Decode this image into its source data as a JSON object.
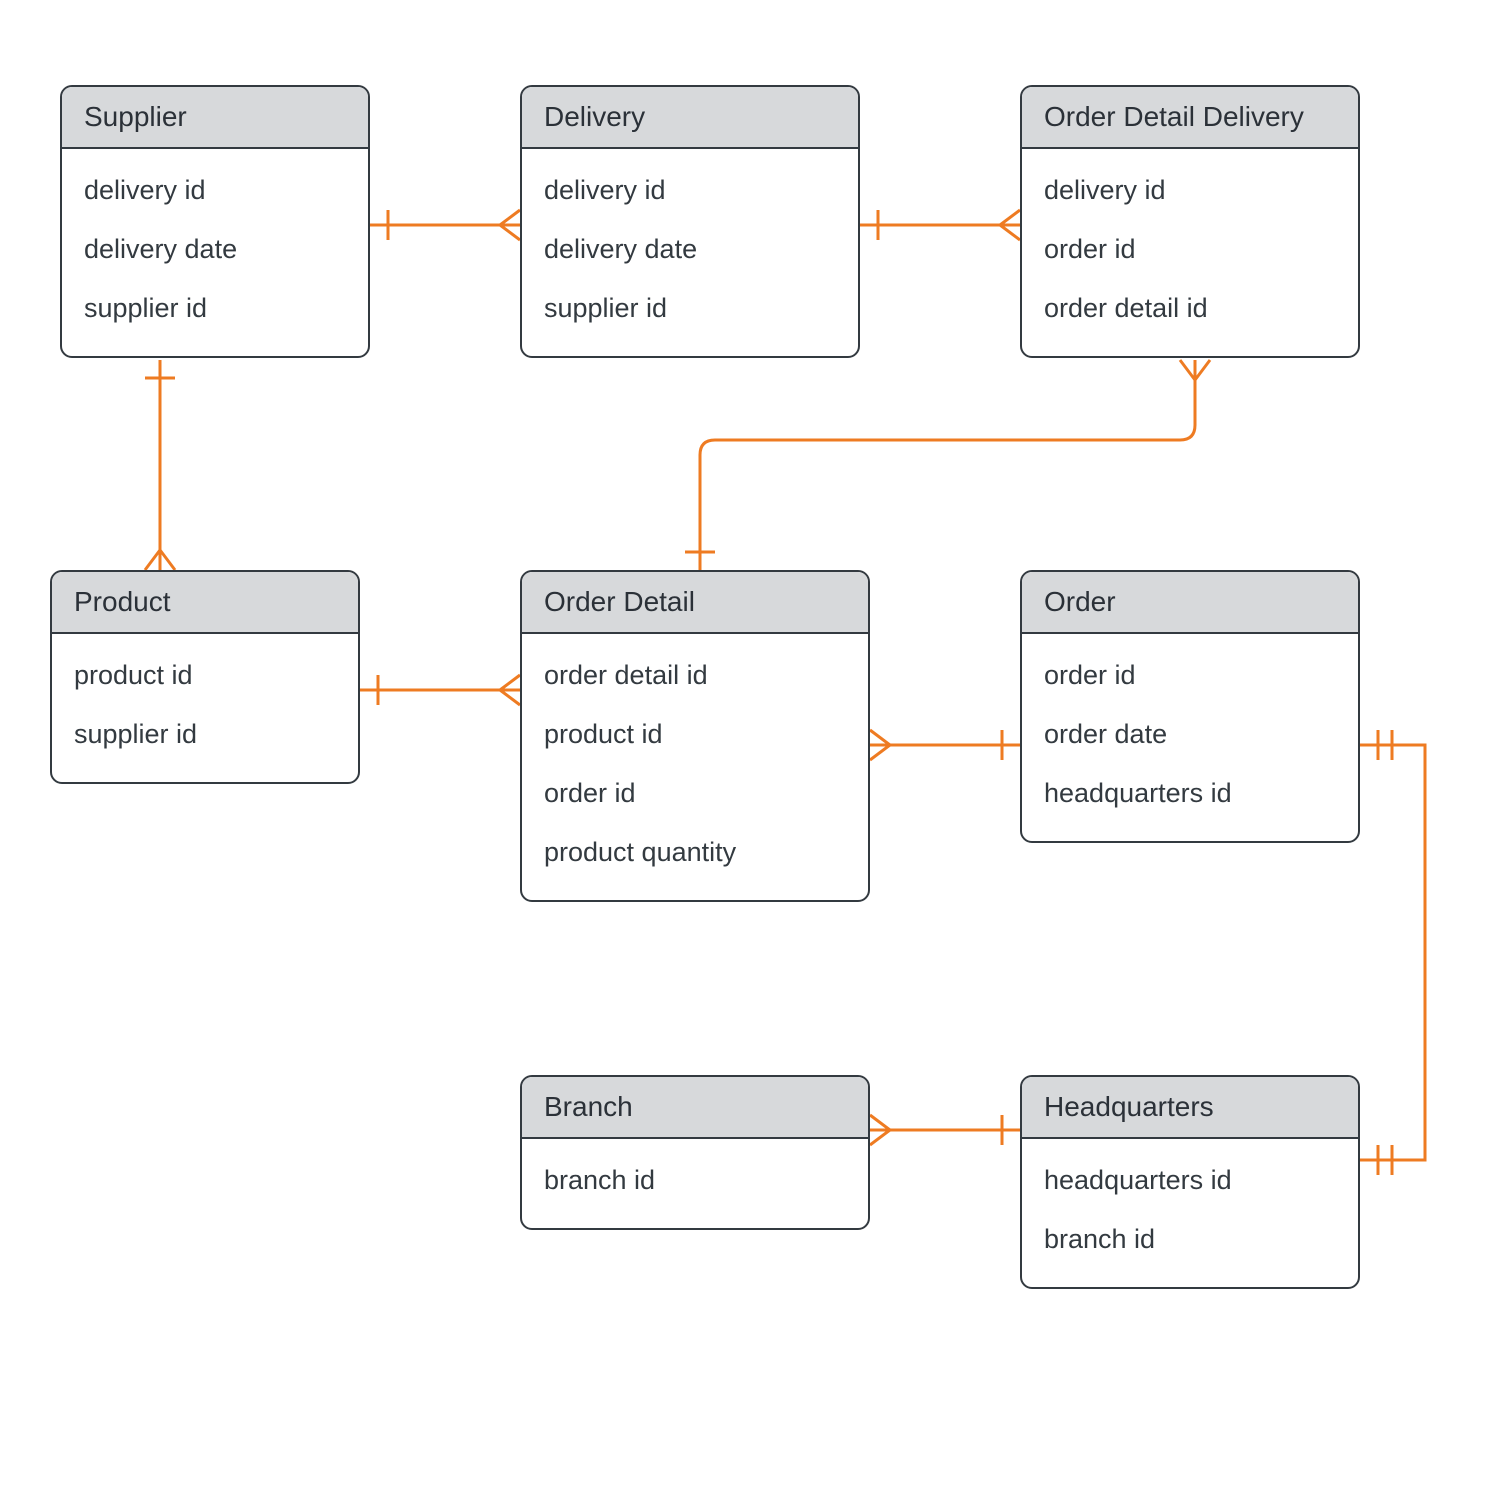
{
  "entities": {
    "supplier": {
      "title": "Supplier",
      "attrs": [
        "delivery id",
        "delivery date",
        "supplier id"
      ]
    },
    "delivery": {
      "title": "Delivery",
      "attrs": [
        "delivery id",
        "delivery date",
        "supplier id"
      ]
    },
    "orderDetailDelivery": {
      "title": "Order Detail Delivery",
      "attrs": [
        "delivery id",
        "order id",
        "order detail id"
      ]
    },
    "product": {
      "title": "Product",
      "attrs": [
        "product id",
        "supplier id"
      ]
    },
    "orderDetail": {
      "title": "Order Detail",
      "attrs": [
        "order detail id",
        "product id",
        "order id",
        "product quantity"
      ]
    },
    "order": {
      "title": "Order",
      "attrs": [
        "order id",
        "order date",
        "headquarters id"
      ]
    },
    "branch": {
      "title": "Branch",
      "attrs": [
        "branch id"
      ]
    },
    "headquarters": {
      "title": "Headquarters",
      "attrs": [
        "headquarters id",
        "branch id"
      ]
    }
  },
  "colors": {
    "connector": "#ee7b22",
    "headerFill": "#d7d9db",
    "border": "#333a40"
  }
}
